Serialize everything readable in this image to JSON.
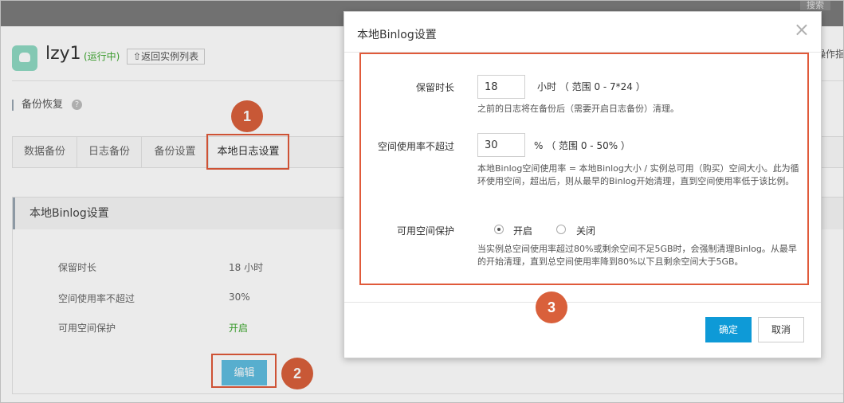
{
  "topbar": {
    "search_label": "搜索"
  },
  "instance": {
    "name": "lzy1",
    "status": "(运行中)",
    "back_label": "返回实例列表",
    "ops_label": "操作指"
  },
  "section": {
    "title": "备份恢复",
    "help": "?"
  },
  "tabs": [
    {
      "label": "数据备份"
    },
    {
      "label": "日志备份"
    },
    {
      "label": "备份设置"
    },
    {
      "label": "本地日志设置"
    }
  ],
  "panel": {
    "title": "本地Binlog设置",
    "rows": [
      {
        "label": "保留时长",
        "value": "18 小时"
      },
      {
        "label": "空间使用率不超过",
        "value": "30%"
      },
      {
        "label": "可用空间保护",
        "value": "开启"
      }
    ],
    "edit_label": "编辑"
  },
  "badges": [
    "1",
    "2",
    "3"
  ],
  "dialog": {
    "title": "本地Binlog设置",
    "close": "×",
    "retention": {
      "label": "保留时长",
      "value": "18",
      "unit": "小时 （ 范围 0 - 7*24 ）",
      "help": "之前的日志将在备份后（需要开启日志备份）清理。"
    },
    "usage": {
      "label": "空间使用率不超过",
      "value": "30",
      "unit": "% （ 范围 0 - 50% ）",
      "help": "本地Binlog空间使用率 = 本地Binlog大小 / 实例总可用（购买）空间大小。此为循环使用空间，超出后，则从最早的Binlog开始清理，直到空间使用率低于该比例。"
    },
    "protection": {
      "label": "可用空间保护",
      "option_on": "开启",
      "option_off": "关闭",
      "help": "当实例总空间使用率超过80%或剩余空间不足5GB时，会强制清理Binlog。从最早的开始清理，直到总空间使用率降到80%以下且剩余空间大于5GB。"
    },
    "ok_label": "确定",
    "cancel_label": "取消"
  }
}
